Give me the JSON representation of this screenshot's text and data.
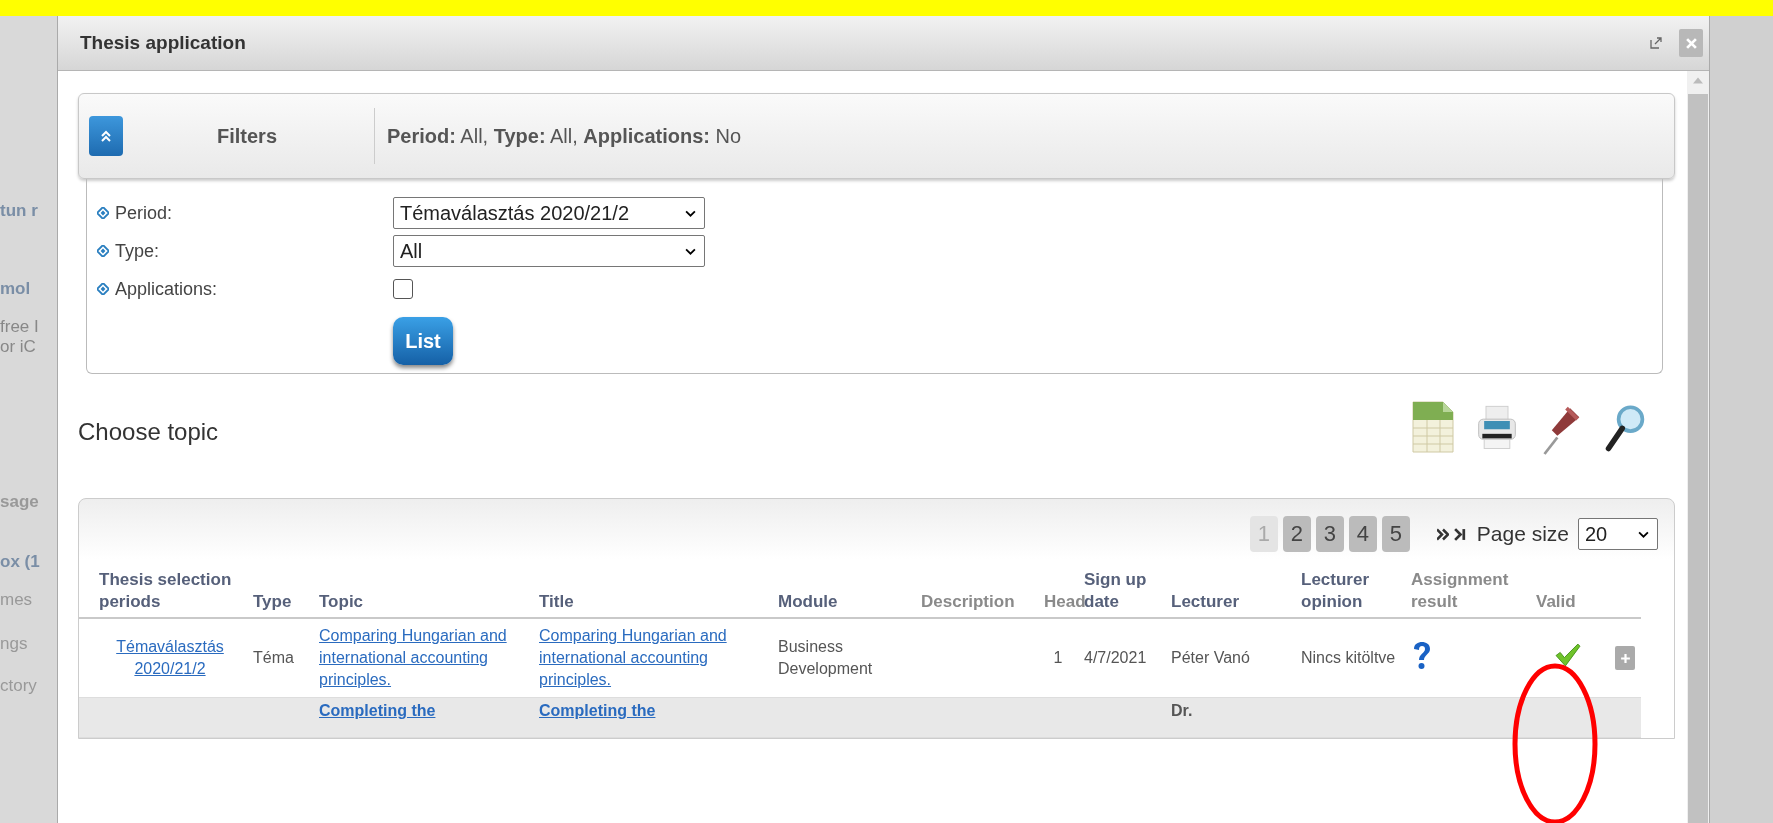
{
  "background_fragments": [
    {
      "text": "tun r",
      "bold": true
    },
    {
      "text": "mol",
      "bold": true
    },
    {
      "text": "free I",
      "bold": false
    },
    {
      "text": "or iC",
      "bold": false
    },
    {
      "text": "sage",
      "bold": true
    },
    {
      "text": "ox (1",
      "bold": true
    },
    {
      "text": "mes",
      "bold": false
    },
    {
      "text": "ngs",
      "bold": false
    },
    {
      "text": "ctory",
      "bold": false
    }
  ],
  "window": {
    "title": "Thesis application"
  },
  "filters": {
    "title": "Filters",
    "expanded": true,
    "summary": "**Period:** All, **Type:** All, **Applications:** No",
    "fields": [
      {
        "kind": "select",
        "label": "Period:",
        "value": "Témaválasztás 2020/21/2"
      },
      {
        "kind": "select",
        "label": "Type:",
        "value": "All"
      },
      {
        "kind": "checkbox",
        "label": "Applications:",
        "checked": false
      }
    ],
    "button": "List"
  },
  "section_title": "Choose topic",
  "pagination": {
    "pages": [
      {
        "label": "1",
        "selected": true
      },
      {
        "label": "2",
        "selected": false
      },
      {
        "label": "3",
        "selected": false
      },
      {
        "label": "4",
        "selected": false
      },
      {
        "label": "5",
        "selected": false
      }
    ],
    "page_size_label": "Page size",
    "page_size": "20"
  },
  "table": {
    "columns": [
      {
        "label": "Thesis selection periods",
        "muted": false
      },
      {
        "label": "Type",
        "muted": false
      },
      {
        "label": "Topic",
        "muted": false
      },
      {
        "label": "Title",
        "muted": false
      },
      {
        "label": "Module",
        "muted": false
      },
      {
        "label": "Description",
        "muted": true
      },
      {
        "label": "Head",
        "muted": true
      },
      {
        "label": "Sign up date",
        "muted": false
      },
      {
        "label": "Lecturer",
        "muted": false
      },
      {
        "label": "Lecturer opinion",
        "muted": false
      },
      {
        "label": "Assignment result",
        "muted": true
      },
      {
        "label": "Valid",
        "muted": true
      }
    ],
    "rows": [
      {
        "highlighted": false,
        "period": "Témaválasztás 2020/21/2",
        "type": "Téma",
        "topic": "Comparing Hungarian and international accounting principles.",
        "title": "Comparing Hungarian and international accounting principles.",
        "module": "Business Development",
        "head": "1",
        "sign_up_date": "4/7/2021",
        "lecturer": "Péter Vanó",
        "lecturer_opinion": "Nincs kitöltve",
        "assignment_unknown": true,
        "valid": true,
        "expandable": true
      },
      {
        "highlighted": true,
        "topic": "Completing the",
        "title": "Completing the",
        "lecturer": "Dr.",
        "assignment_unknown": false,
        "valid": false,
        "expandable": false
      }
    ]
  },
  "annotation": {
    "kind": "ellipse",
    "color": "#ff0000"
  }
}
